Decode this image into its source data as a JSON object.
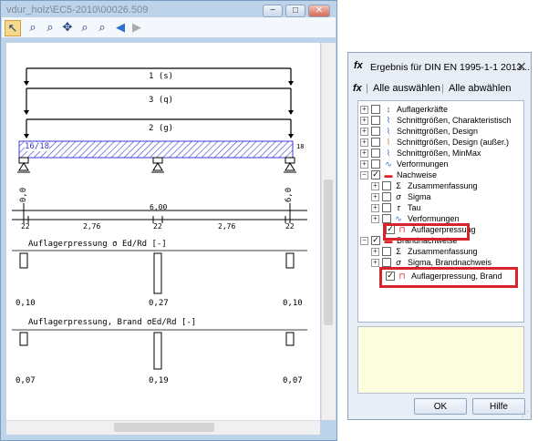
{
  "left_window": {
    "title": "vdur_holz\\EC5-2010\\00026.509",
    "controls": [
      "−",
      "□",
      "✕"
    ]
  },
  "toolbar": {
    "tools": [
      "arrow-pointer-icon",
      "zoom-fit-icon",
      "zoom-in-icon",
      "pan-icon",
      "zoom-window-icon",
      "zoom-out-icon",
      "back-icon",
      "forward-icon"
    ]
  },
  "drawing": {
    "loads": [
      "1 (s)",
      "3 (q)",
      "2 (g)"
    ],
    "beam_label": "16/18",
    "beam_height": "18",
    "dim_left": "0,0",
    "dim_right": "6,0",
    "span_total": "6,00",
    "segments": [
      "22",
      "2,76",
      "22",
      "2,76",
      "22"
    ],
    "result1_title": "Auflagerpressung σ Ed/Rd [-]",
    "result1_values": [
      "0,10",
      "0,27",
      "0,10"
    ],
    "result2_title": "Auflagerpressung, Brand σEd/Rd [-]",
    "result2_values": [
      "0,07",
      "0,19",
      "0,07"
    ]
  },
  "dialog": {
    "icon": "fx",
    "title": "Ergebnis für DIN EN 1995-1-1 2013...",
    "close": "✕",
    "select_all": "Alle auswählen",
    "deselect_all": "Alle abwählen",
    "tree": [
      {
        "label": "Auflagerkräfte",
        "level": 0,
        "checked": false,
        "icon": "support-force-icon"
      },
      {
        "label": "Schnittgrößen, Charakteristisch",
        "level": 0,
        "checked": false,
        "icon": "internal-forces-icon"
      },
      {
        "label": "Schnittgrößen, Design",
        "level": 0,
        "checked": false,
        "icon": "internal-forces-icon"
      },
      {
        "label": "Schnittgrößen, Design (außer.)",
        "level": 0,
        "checked": false,
        "icon": "internal-forces-icon"
      },
      {
        "label": "Schnittgrößen, MinMax",
        "level": 0,
        "checked": false,
        "icon": "internal-forces-icon"
      },
      {
        "label": "Verformungen",
        "level": 0,
        "checked": false,
        "icon": "deformation-icon"
      },
      {
        "label": "Nachweise",
        "level": 0,
        "checked": true,
        "icon": "verification-icon"
      },
      {
        "label": "Zusammenfassung",
        "level": 1,
        "checked": false,
        "icon": "sigma-sum-icon"
      },
      {
        "label": "Sigma",
        "level": 1,
        "checked": false,
        "icon": "sigma-icon"
      },
      {
        "label": "Tau",
        "level": 1,
        "checked": false,
        "icon": "tau-icon"
      },
      {
        "label": "Verformungen",
        "level": 1,
        "checked": false,
        "icon": "deformation-icon"
      },
      {
        "label": "Auflagerpressung",
        "level": 1,
        "checked": true,
        "icon": "bearing-pressure-icon"
      },
      {
        "label": "Brandnachweise",
        "level": 0,
        "checked": true,
        "icon": "fire-verification-icon"
      },
      {
        "label": "Zusammenfassung",
        "level": 1,
        "checked": false,
        "icon": "sigma-sum-icon"
      },
      {
        "label": "Sigma, Brandnachweis",
        "level": 1,
        "checked": false,
        "icon": "sigma-icon"
      },
      {
        "label": "Auflagerpressung, Brand",
        "level": 1,
        "checked": true,
        "icon": "bearing-pressure-icon"
      }
    ],
    "ok": "OK",
    "help": "Hilfe"
  },
  "colors": {
    "highlight": "#d8232a",
    "beam": "#3b3bd6",
    "info_bg": "#fdfde0"
  }
}
